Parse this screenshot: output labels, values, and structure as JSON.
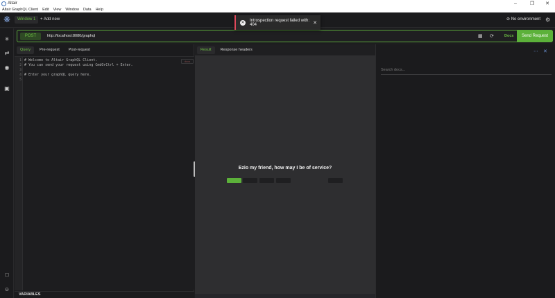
{
  "window": {
    "title": "Altair"
  },
  "menubar": [
    "Altair GraphQL Client",
    "Edit",
    "View",
    "Window",
    "Data",
    "Help"
  ],
  "header": {
    "window_tab": "Window 1",
    "add_new": "+ Add new",
    "environment": "No environment"
  },
  "toast": {
    "message": "Introspection request failed with: 404",
    "type": "error"
  },
  "request": {
    "method": "POST",
    "url": "http://localhost:8080/graphql",
    "docs_label": "Docs",
    "send_label": "Send Request"
  },
  "query": {
    "tabs": [
      "Query",
      "Pre-request",
      "Post-request"
    ],
    "active_tab": "Query",
    "line_numbers": [
      "1",
      "2",
      "3",
      "4",
      "5"
    ],
    "code_lines": [
      "# Welcome to Altair GraphQL Client.",
      "# You can send your request using CmdOrCtrl + Enter.",
      "",
      "# Enter your graphQL query here.",
      ""
    ],
    "code_tag": "docs",
    "variables_label": "VARIABLES"
  },
  "result": {
    "tabs": [
      "Result",
      "Response headers"
    ],
    "active_tab": "Result",
    "greeting": "Ezio my friend, how may I be of service?"
  },
  "docs": {
    "search_placeholder": "Search docs..."
  },
  "colors": {
    "accent": "#5cb13a",
    "accent_text": "#6ec044",
    "error": "#e0495b",
    "background": "#1d1d1f"
  }
}
